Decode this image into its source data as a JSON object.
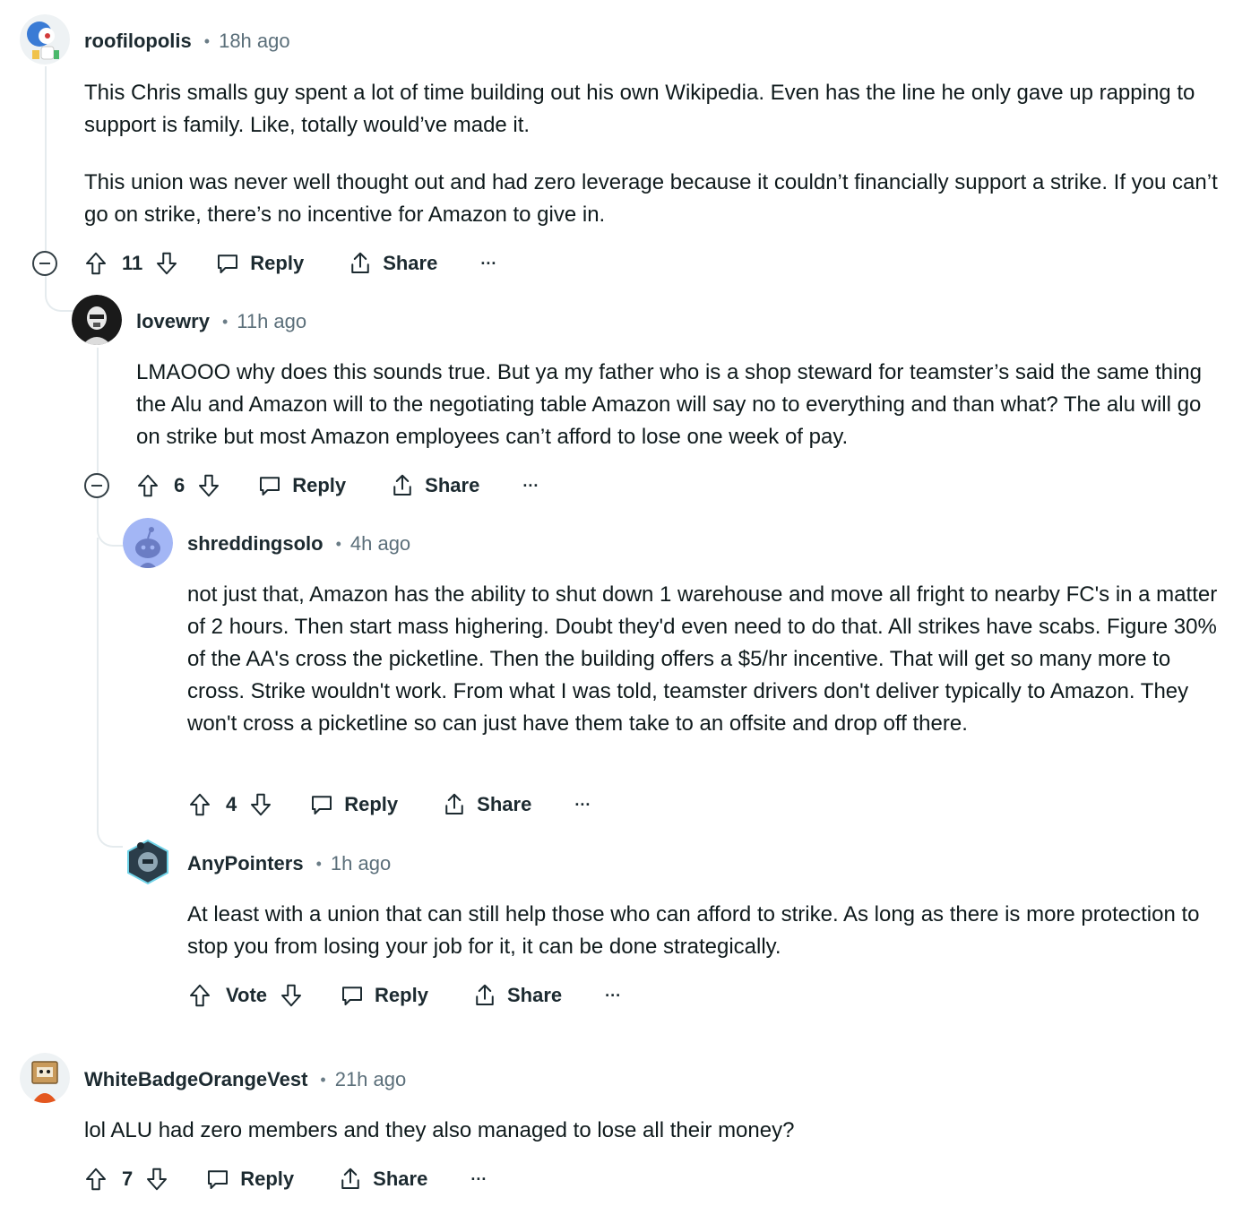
{
  "comments": [
    {
      "author": "roofilopolis",
      "time": "18h ago",
      "paragraphs": [
        "This Chris smalls guy spent a lot of time building out his own Wikipedia. Even has the line he only gave up rapping to support is family. Like, totally would’ve made it.",
        "This union was never well thought out and had zero leverage because it couldn’t financially support a strike. If you can’t go on strike, there’s no incentive for Amazon to give in."
      ],
      "score": "11",
      "reply_label": "Reply",
      "share_label": "Share",
      "more_label": "···"
    },
    {
      "author": "lovewry",
      "time": "11h ago",
      "paragraphs": [
        "LMAOOO why does this sounds true. But ya my father who is a shop steward for teamster’s said the same thing the Alu and Amazon will to the negotiating table Amazon will say no to everything and than what? The alu will go on strike but most Amazon employees can’t afford to lose one week of pay."
      ],
      "score": "6",
      "reply_label": "Reply",
      "share_label": "Share",
      "more_label": "···"
    },
    {
      "author": "shreddingsolo",
      "time": "4h ago",
      "paragraphs": [
        "not just that, Amazon has the ability to shut down 1 warehouse and move all fright to nearby FC's in a matter of 2 hours. Then start mass highering. Doubt they'd even need to do that. All strikes have scabs. Figure 30% of the AA's cross the picketline. Then the building offers a $5/hr incentive. That will get so many more to cross. Strike wouldn't work. From what I was told, teamster drivers don't deliver typically to Amazon. They won't cross a picketline so can just have them take to an offsite and drop off there."
      ],
      "score": "4",
      "reply_label": "Reply",
      "share_label": "Share",
      "more_label": "···"
    },
    {
      "author": "AnyPointers",
      "time": "1h ago",
      "paragraphs": [
        "At least with a union that can still help those who can afford to strike. As long as there is more protection to stop you from losing your job for it, it can be done strategically."
      ],
      "score": "Vote",
      "reply_label": "Reply",
      "share_label": "Share",
      "more_label": "···"
    },
    {
      "author": "WhiteBadgeOrangeVest",
      "time": "21h ago",
      "paragraphs": [
        "lol ALU had zero members and they also managed to lose all their money?"
      ],
      "score": "7",
      "reply_label": "Reply",
      "share_label": "Share",
      "more_label": "···"
    }
  ],
  "icons": [
    "upvote-icon",
    "downvote-icon",
    "reply-bubble-icon",
    "share-icon",
    "more-icon",
    "collapse-icon"
  ],
  "colors": {
    "text": "#0f1a1c",
    "meta": "#5b6f7a",
    "thread_line": "#e5ebee"
  }
}
